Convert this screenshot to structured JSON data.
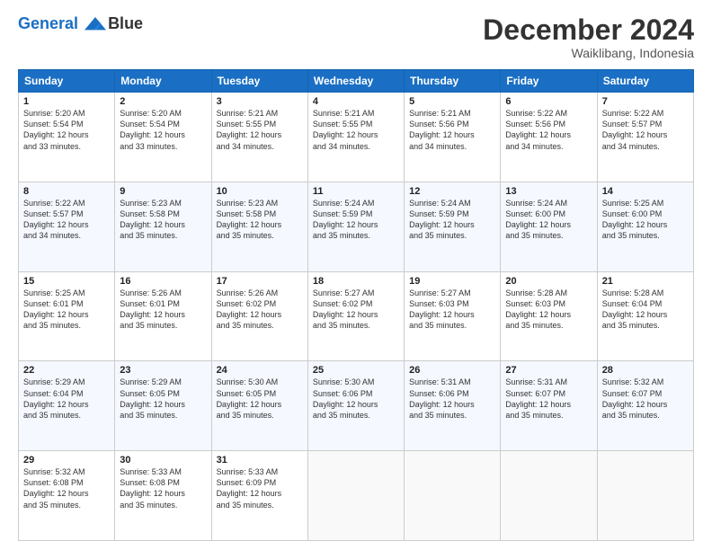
{
  "logo": {
    "line1": "General",
    "line2": "Blue"
  },
  "title": "December 2024",
  "subtitle": "Waiklibang, Indonesia",
  "header_days": [
    "Sunday",
    "Monday",
    "Tuesday",
    "Wednesday",
    "Thursday",
    "Friday",
    "Saturday"
  ],
  "weeks": [
    [
      {
        "day": "1",
        "info": "Sunrise: 5:20 AM\nSunset: 5:54 PM\nDaylight: 12 hours\nand 33 minutes."
      },
      {
        "day": "2",
        "info": "Sunrise: 5:20 AM\nSunset: 5:54 PM\nDaylight: 12 hours\nand 33 minutes."
      },
      {
        "day": "3",
        "info": "Sunrise: 5:21 AM\nSunset: 5:55 PM\nDaylight: 12 hours\nand 34 minutes."
      },
      {
        "day": "4",
        "info": "Sunrise: 5:21 AM\nSunset: 5:55 PM\nDaylight: 12 hours\nand 34 minutes."
      },
      {
        "day": "5",
        "info": "Sunrise: 5:21 AM\nSunset: 5:56 PM\nDaylight: 12 hours\nand 34 minutes."
      },
      {
        "day": "6",
        "info": "Sunrise: 5:22 AM\nSunset: 5:56 PM\nDaylight: 12 hours\nand 34 minutes."
      },
      {
        "day": "7",
        "info": "Sunrise: 5:22 AM\nSunset: 5:57 PM\nDaylight: 12 hours\nand 34 minutes."
      }
    ],
    [
      {
        "day": "8",
        "info": "Sunrise: 5:22 AM\nSunset: 5:57 PM\nDaylight: 12 hours\nand 34 minutes."
      },
      {
        "day": "9",
        "info": "Sunrise: 5:23 AM\nSunset: 5:58 PM\nDaylight: 12 hours\nand 35 minutes."
      },
      {
        "day": "10",
        "info": "Sunrise: 5:23 AM\nSunset: 5:58 PM\nDaylight: 12 hours\nand 35 minutes."
      },
      {
        "day": "11",
        "info": "Sunrise: 5:24 AM\nSunset: 5:59 PM\nDaylight: 12 hours\nand 35 minutes."
      },
      {
        "day": "12",
        "info": "Sunrise: 5:24 AM\nSunset: 5:59 PM\nDaylight: 12 hours\nand 35 minutes."
      },
      {
        "day": "13",
        "info": "Sunrise: 5:24 AM\nSunset: 6:00 PM\nDaylight: 12 hours\nand 35 minutes."
      },
      {
        "day": "14",
        "info": "Sunrise: 5:25 AM\nSunset: 6:00 PM\nDaylight: 12 hours\nand 35 minutes."
      }
    ],
    [
      {
        "day": "15",
        "info": "Sunrise: 5:25 AM\nSunset: 6:01 PM\nDaylight: 12 hours\nand 35 minutes."
      },
      {
        "day": "16",
        "info": "Sunrise: 5:26 AM\nSunset: 6:01 PM\nDaylight: 12 hours\nand 35 minutes."
      },
      {
        "day": "17",
        "info": "Sunrise: 5:26 AM\nSunset: 6:02 PM\nDaylight: 12 hours\nand 35 minutes."
      },
      {
        "day": "18",
        "info": "Sunrise: 5:27 AM\nSunset: 6:02 PM\nDaylight: 12 hours\nand 35 minutes."
      },
      {
        "day": "19",
        "info": "Sunrise: 5:27 AM\nSunset: 6:03 PM\nDaylight: 12 hours\nand 35 minutes."
      },
      {
        "day": "20",
        "info": "Sunrise: 5:28 AM\nSunset: 6:03 PM\nDaylight: 12 hours\nand 35 minutes."
      },
      {
        "day": "21",
        "info": "Sunrise: 5:28 AM\nSunset: 6:04 PM\nDaylight: 12 hours\nand 35 minutes."
      }
    ],
    [
      {
        "day": "22",
        "info": "Sunrise: 5:29 AM\nSunset: 6:04 PM\nDaylight: 12 hours\nand 35 minutes."
      },
      {
        "day": "23",
        "info": "Sunrise: 5:29 AM\nSunset: 6:05 PM\nDaylight: 12 hours\nand 35 minutes."
      },
      {
        "day": "24",
        "info": "Sunrise: 5:30 AM\nSunset: 6:05 PM\nDaylight: 12 hours\nand 35 minutes."
      },
      {
        "day": "25",
        "info": "Sunrise: 5:30 AM\nSunset: 6:06 PM\nDaylight: 12 hours\nand 35 minutes."
      },
      {
        "day": "26",
        "info": "Sunrise: 5:31 AM\nSunset: 6:06 PM\nDaylight: 12 hours\nand 35 minutes."
      },
      {
        "day": "27",
        "info": "Sunrise: 5:31 AM\nSunset: 6:07 PM\nDaylight: 12 hours\nand 35 minutes."
      },
      {
        "day": "28",
        "info": "Sunrise: 5:32 AM\nSunset: 6:07 PM\nDaylight: 12 hours\nand 35 minutes."
      }
    ],
    [
      {
        "day": "29",
        "info": "Sunrise: 5:32 AM\nSunset: 6:08 PM\nDaylight: 12 hours\nand 35 minutes."
      },
      {
        "day": "30",
        "info": "Sunrise: 5:33 AM\nSunset: 6:08 PM\nDaylight: 12 hours\nand 35 minutes."
      },
      {
        "day": "31",
        "info": "Sunrise: 5:33 AM\nSunset: 6:09 PM\nDaylight: 12 hours\nand 35 minutes."
      },
      null,
      null,
      null,
      null
    ]
  ]
}
